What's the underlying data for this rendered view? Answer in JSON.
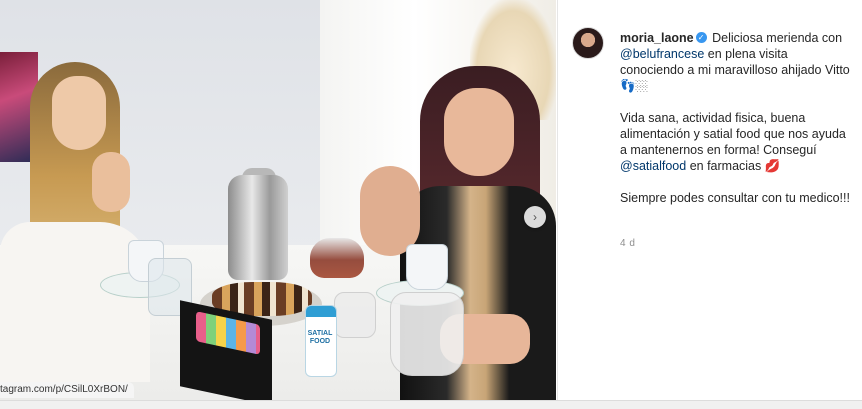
{
  "post": {
    "url_text": "tagram.com/p/CSilL0XrBON/",
    "next_glyph": "›",
    "jar_label": "SATIAL FOOD"
  },
  "panel": {
    "username": "moria_laone",
    "verified_glyph": "✓",
    "caption_p1_text": "Deliciosa merienda con",
    "mention_1": "@belufrancese",
    "caption_p1_text2": "en plena visita conociendo a mi maravilloso ahijado Vitto 👣🏼",
    "caption_p2_text": "Vida sana, actividad fisica, buena alimentación y satial food que nos ayuda a mantenernos en forma! Conseguí",
    "mention_2": "@satialfood",
    "caption_p2_text2": "en farmacias 💋",
    "caption_p3_text": "Siempre podes consultar con tu medico!!!",
    "timestamp": "4 d"
  },
  "colors": {
    "mention": "#00376b",
    "verified": "#3897f0",
    "timestamp": "#8e8e8e"
  }
}
